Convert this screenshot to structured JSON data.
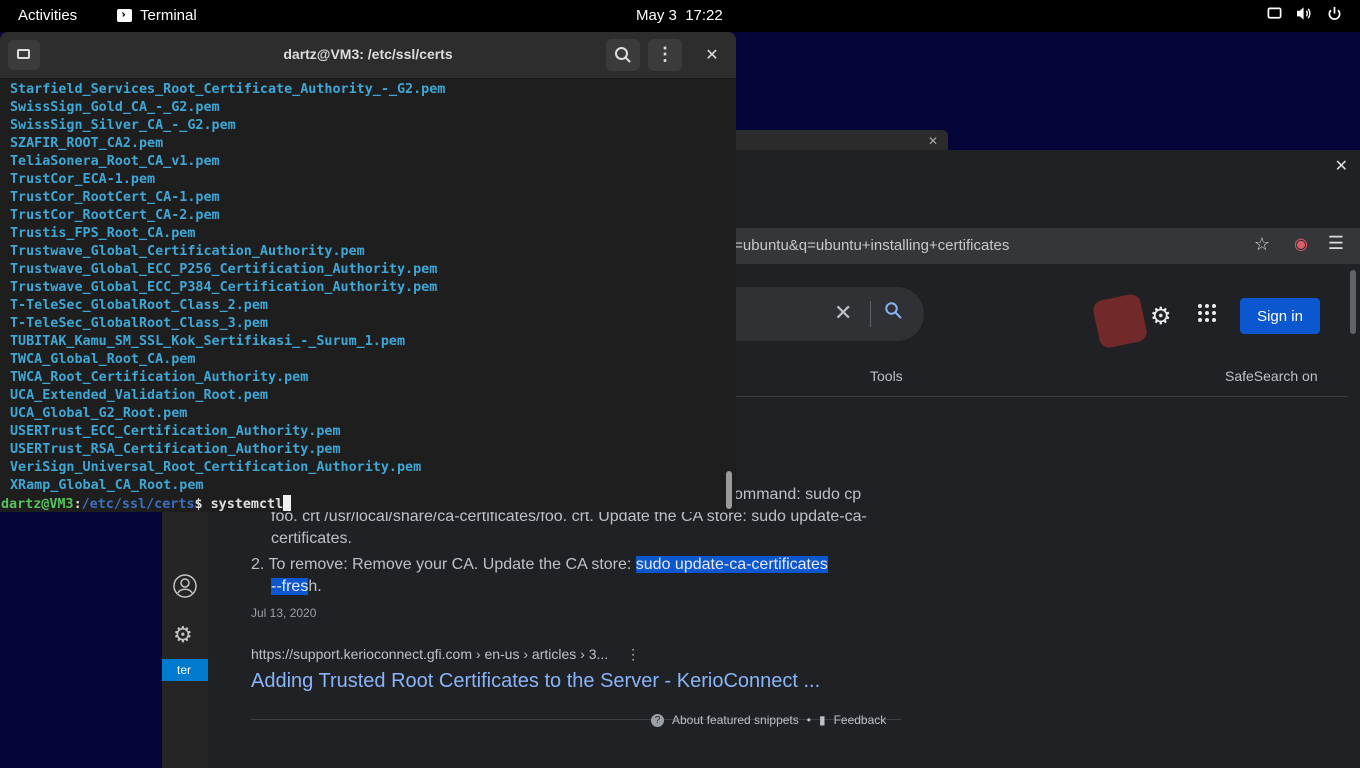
{
  "topbar": {
    "activities": "Activities",
    "app_name": "Terminal",
    "date": "May 3",
    "time": "17:22",
    "tray_icons": [
      "screen-icon",
      "volume-icon",
      "power-icon"
    ]
  },
  "terminal": {
    "title": "dartz@VM3: /etc/ssl/certs",
    "close_glyph": "✕",
    "menu_glyph": "⋮",
    "lines": [
      "Starfield_Services_Root_Certificate_Authority_-_G2.pem",
      "SwissSign_Gold_CA_-_G2.pem",
      "SwissSign_Silver_CA_-_G2.pem",
      "SZAFIR_ROOT_CA2.pem",
      "TeliaSonera_Root_CA_v1.pem",
      "TrustCor_ECA-1.pem",
      "TrustCor_RootCert_CA-1.pem",
      "TrustCor_RootCert_CA-2.pem",
      "Trustis_FPS_Root_CA.pem",
      "Trustwave_Global_Certification_Authority.pem",
      "Trustwave_Global_ECC_P256_Certification_Authority.pem",
      "Trustwave_Global_ECC_P384_Certification_Authority.pem",
      "T-TeleSec_GlobalRoot_Class_2.pem",
      "T-TeleSec_GlobalRoot_Class_3.pem",
      "TUBITAK_Kamu_SM_SSL_Kok_Sertifikasi_-_Surum_1.pem",
      "TWCA_Global_Root_CA.pem",
      "TWCA_Root_Certification_Authority.pem",
      "UCA_Extended_Validation_Root.pem",
      "UCA_Global_G2_Root.pem",
      "USERTrust_ECC_Certification_Authority.pem",
      "USERTrust_RSA_Certification_Authority.pem",
      "VeriSign_Universal_Root_Certification_Authority.pem",
      "XRamp_Global_CA_Root.pem"
    ],
    "prompt_user": "dartz@VM3",
    "prompt_colon": ":",
    "prompt_path": "/etc/ssl/certs",
    "prompt_symbol": "$ ",
    "command": "systemctl"
  },
  "browser": {
    "url_fragment": "t=ubuntu&q=ubuntu+installing+certificates",
    "signin_label": "Sign in",
    "tools_label": "Tools",
    "safesearch_label": "SafeSearch on",
    "tab_close": "✕",
    "window_close": "✕",
    "snippet": {
      "line1": "ommand: sudo cp",
      "line2": "foo. crt /usr/local/share/ca-certificates/foo. crt. Update the CA store: sudo update-ca-",
      "line3": "certificates.",
      "line4_prefix": "2.  To remove: Remove your CA. Update the CA store: ",
      "line4_highlight": "sudo update-ca-certificates",
      "line5_highlight": "--fres",
      "line5_suffix": "h.",
      "date": "Jul 13, 2020"
    },
    "result": {
      "url": "https://support.kerioconnect.gfi.com › en-us › articles › 3...",
      "title": "Adding Trusted Root Certificates to the Server - KerioConnect ..."
    },
    "footer": {
      "about": "About featured snippets",
      "bullet": "•",
      "feedback": "Feedback"
    }
  },
  "vscode": {
    "status_text": "ter"
  },
  "colors": {
    "terminal_bg": "#1e1e1e",
    "file_blue": "#3fa7d6",
    "prompt_green": "#57c25e",
    "prompt_path": "#3d6fc0",
    "link_blue": "#8ab4f8",
    "signin_blue": "#0b57d0"
  }
}
